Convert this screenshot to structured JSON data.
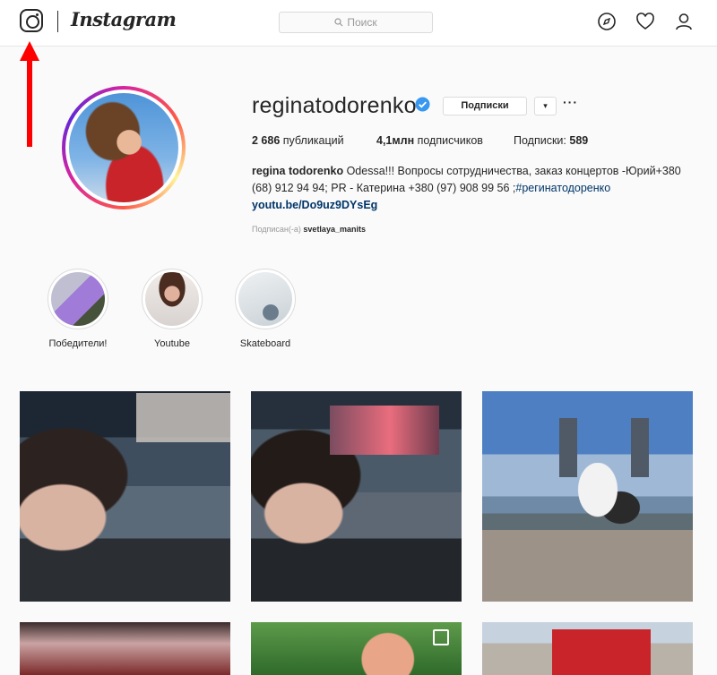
{
  "nav": {
    "brand": "Instagram",
    "search_placeholder": "Поиск",
    "icons": [
      "instagram-logo-icon",
      "search-icon",
      "compass-icon",
      "heart-icon",
      "profile-icon"
    ]
  },
  "annotation": {
    "arrow_color": "#ff0000",
    "points_to": "instagram-logo-icon"
  },
  "profile": {
    "username": "reginatodorenko",
    "verified": true,
    "follow_label": "Подписки",
    "dropdown_glyph": "▾",
    "more_glyph": "···",
    "stats": {
      "posts": "2 686",
      "posts_label": "публикаций",
      "followers": "4,1млн",
      "followers_label": "подписчиков",
      "following_label": "Подписки:",
      "following": "589"
    },
    "bio": {
      "name": "regina todorenko",
      "line1": "Odessa!!! Вопросы сотрудничества, заказ концертов -Юрий+380",
      "line2_pre": "(68) 912 94 94; PR - Катерина +380 (97) 908 99 56 ;",
      "hashtag": "#регинатодоренко",
      "link": "youtu.be/Do9uz9DYsEg"
    },
    "followed_by_label": "Подписан(-а)",
    "followed_by_user": "svetlaya_manits"
  },
  "highlights": [
    {
      "label": "Победители!"
    },
    {
      "label": "Youtube"
    },
    {
      "label": "Skateboard"
    }
  ],
  "colors": {
    "link": "#003569",
    "verified": "#3897f0",
    "annotation": "#ff0000",
    "border": "#dbdbdb"
  }
}
